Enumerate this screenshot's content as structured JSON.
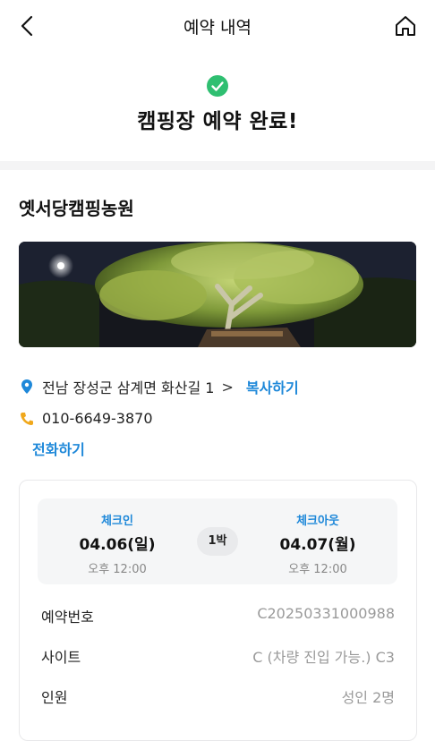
{
  "header": {
    "title": "예약 내역",
    "back_icon": "chevron-left-icon",
    "home_icon": "home-icon"
  },
  "status": {
    "icon": "check-circle-icon",
    "icon_color": "#2fbf71",
    "text": "캠핑장 예약 완료!"
  },
  "campsite": {
    "name": "옛서당캠핑농원",
    "address": "전남 장성군 삼계면 화산길 1",
    "address_chevron": ">",
    "copy_label": "복사하기",
    "phone": "010-6649-3870",
    "call_label": "전화하기",
    "link_color": "#1e88d9"
  },
  "reservation": {
    "checkin": {
      "label": "체크인",
      "date": "04.06(일)",
      "time": "오후 12:00"
    },
    "nights": "1박",
    "checkout": {
      "label": "체크아웃",
      "date": "04.07(월)",
      "time": "오후 12:00"
    },
    "rows": [
      {
        "label": "예약번호",
        "value": "C20250331000988"
      },
      {
        "label": "사이트",
        "value": "C (차량 진입 가능.) C3"
      },
      {
        "label": "인원",
        "value": "성인 2명"
      }
    ]
  }
}
